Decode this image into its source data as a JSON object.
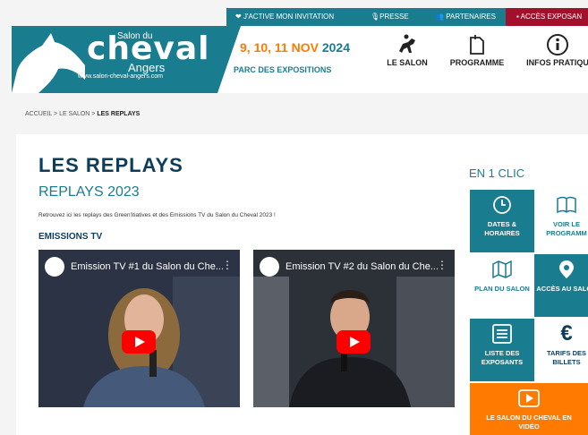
{
  "colors": {
    "primary": "#1a7c8f",
    "dark": "#0e3d5c",
    "orange": "#ff7a00",
    "crimson": "#a3102c"
  },
  "topbar": {
    "activate": "J'ACTIVE MON INVITATION",
    "press": "PRESSE",
    "partners": "PARTENAIRES",
    "exhibitors": "ACCÈS EXPOSAN"
  },
  "logo": {
    "salon_du": "Salon du",
    "cheval": "cheval",
    "angers": "Angers",
    "url": "www.salon-cheval-angers.com"
  },
  "event": {
    "dates": "9, 10, 11 NOV",
    "year": "2024",
    "venue": "PARC DES EXPOSITIONS"
  },
  "nav": {
    "salon": "LE SALON",
    "programme": "PROGRAMME",
    "infos": "INFOS PRATIQU"
  },
  "breadcrumb": {
    "home": "ACCUEIL",
    "sep": ">",
    "salon": "LE SALON",
    "current": "LES REPLAYS"
  },
  "main": {
    "title": "LES REPLAYS",
    "subtitle": "REPLAYS 2023",
    "intro": "Retrouvez ici les replays des Green'itiatives et des Emissions TV du Salon du Cheval 2023 !",
    "section": "EMISSIONS TV",
    "videos": [
      {
        "title": "Emission TV #1 du Salon du Che..."
      },
      {
        "title": "Emission TV #2 du Salon du Che..."
      }
    ]
  },
  "sidebar": {
    "title": "EN 1 CLIC",
    "tiles": [
      {
        "label": "DATES & HORAIRES",
        "icon": "clock-icon"
      },
      {
        "label": "VOIR LE PROGRAMM",
        "icon": "book-icon"
      },
      {
        "label": "PLAN DU SALON",
        "icon": "map-icon"
      },
      {
        "label": "ACCÈS AU SALON",
        "icon": "location-pin-icon"
      },
      {
        "label": "LISTE DES EXPOSANTS",
        "icon": "list-icon"
      },
      {
        "label": "TARIFS DES BILLETS",
        "icon": "euro-icon"
      },
      {
        "label": "LE SALON DU CHEVAL EN VIDÉO",
        "icon": "play-icon"
      }
    ]
  }
}
